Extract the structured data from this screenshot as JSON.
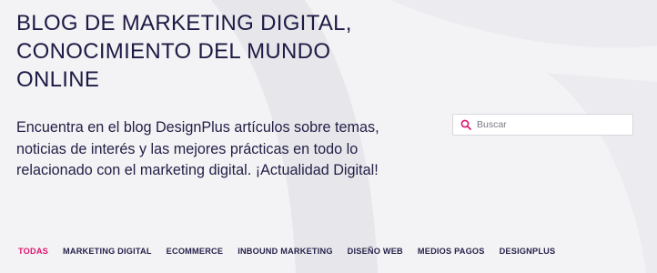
{
  "header": {
    "title_lines": [
      "BLOG DE MARKETING DIGITAL,",
      "CONOCIMIENTO DEL MUNDO",
      "ONLINE"
    ]
  },
  "intro": {
    "lines": [
      "Encuentra en el blog DesignPlus artículos sobre temas,",
      "noticias de interés y las mejores prácticas en todo lo",
      "relacionado con el marketing digital. ¡Actualidad Digital!"
    ]
  },
  "search": {
    "placeholder": "Buscar",
    "value": "",
    "icon": "search-icon",
    "icon_color": "#e0146e"
  },
  "categories": {
    "items": [
      {
        "label": "TODAS",
        "active": true
      },
      {
        "label": "MARKETING DIGITAL",
        "active": false
      },
      {
        "label": "ECOMMERCE",
        "active": false
      },
      {
        "label": "INBOUND MARKETING",
        "active": false
      },
      {
        "label": "DISEÑO WEB",
        "active": false
      },
      {
        "label": "MEDIOS PAGOS",
        "active": false
      },
      {
        "label": "DESIGNPLUS",
        "active": false
      }
    ]
  },
  "colors": {
    "background": "#f3f3f5",
    "text_dark": "#1d1a45",
    "accent": "#e0146e"
  }
}
